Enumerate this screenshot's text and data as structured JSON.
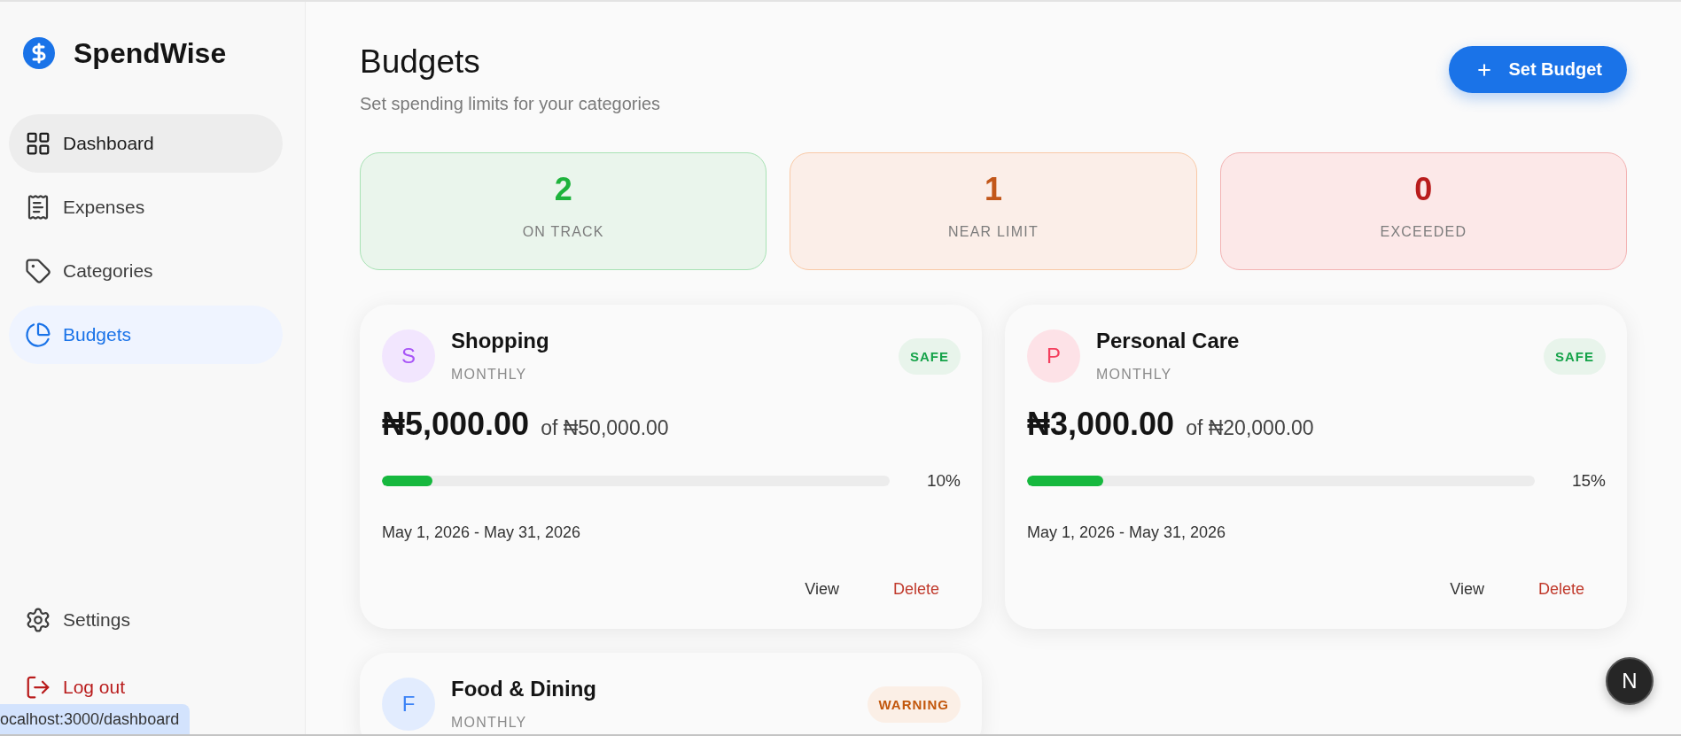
{
  "sidebar": {
    "brand": "SpendWise",
    "nav": [
      {
        "label": "Dashboard",
        "selected": false,
        "hovered": true
      },
      {
        "label": "Expenses",
        "selected": false,
        "hovered": false
      },
      {
        "label": "Categories",
        "selected": false,
        "hovered": false
      },
      {
        "label": "Budgets",
        "selected": true,
        "hovered": false
      }
    ],
    "footer": [
      {
        "label": "Settings",
        "kind": "normal"
      },
      {
        "label": "Log out",
        "kind": "danger"
      }
    ]
  },
  "header": {
    "title": "Budgets",
    "subtitle": "Set spending limits for your categories",
    "action": "Set Budget"
  },
  "summary": [
    {
      "value": "2",
      "label": "ON TRACK",
      "kind": "good"
    },
    {
      "value": "1",
      "label": "NEAR LIMIT",
      "kind": "warn"
    },
    {
      "value": "0",
      "label": "EXCEEDED",
      "kind": "bad"
    }
  ],
  "budgets": [
    {
      "initial": "S",
      "color": "#a855f7",
      "name": "Shopping",
      "period": "MONTHLY",
      "status": {
        "label": "SAFE",
        "kind": "safe"
      },
      "spent": "₦5,000.00",
      "limit": "of ₦50,000.00",
      "level": 0.1,
      "percent": "10%",
      "dates": "May 1, 2026 - May 31, 2026",
      "actions": [
        {
          "label": "View",
          "kind": "normal"
        },
        {
          "label": "Delete",
          "kind": "danger"
        }
      ]
    },
    {
      "initial": "P",
      "color": "#f43f5e",
      "name": "Personal Care",
      "period": "MONTHLY",
      "status": {
        "label": "SAFE",
        "kind": "safe"
      },
      "spent": "₦3,000.00",
      "limit": "of ₦20,000.00",
      "level": 0.15,
      "percent": "15%",
      "dates": "May 1, 2026 - May 31, 2026",
      "actions": [
        {
          "label": "View",
          "kind": "normal"
        },
        {
          "label": "Delete",
          "kind": "danger"
        }
      ]
    },
    {
      "initial": "F",
      "color": "#3b82f6",
      "name": "Food & Dining",
      "period": "MONTHLY",
      "status": {
        "label": "WARNING",
        "kind": "warning"
      }
    }
  ],
  "status_url": "ocalhost:3000/dashboard",
  "dev_badge": "N"
}
